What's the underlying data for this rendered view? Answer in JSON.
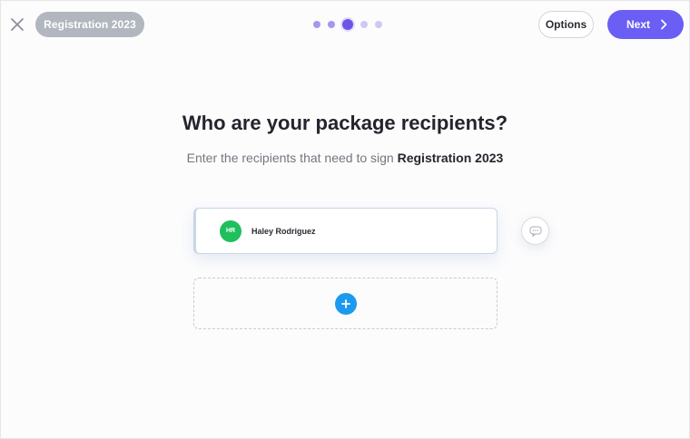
{
  "header": {
    "close_icon": "close-icon",
    "package_name": "Registration 2023",
    "steps": {
      "total": 5,
      "current": 3
    },
    "options_label": "Options",
    "next_label": "Next",
    "next_icon": "chevron-right-icon"
  },
  "main": {
    "title": "Who are your package recipients?",
    "subtitle_prefix": "Enter the recipients that need to sign",
    "subtitle_package": "Registration 2023"
  },
  "recipients": [
    {
      "initials": "HR",
      "name": "Haley Rodriguez",
      "avatar_color": "#1fbf5d"
    }
  ],
  "add_recipient": {
    "icon": "plus-icon",
    "color": "#1b9af0"
  },
  "colors": {
    "accent": "#6b5ef5",
    "pill": "#b1b6bf",
    "add": "#1b9af0",
    "avatar": "#1fbf5d"
  }
}
